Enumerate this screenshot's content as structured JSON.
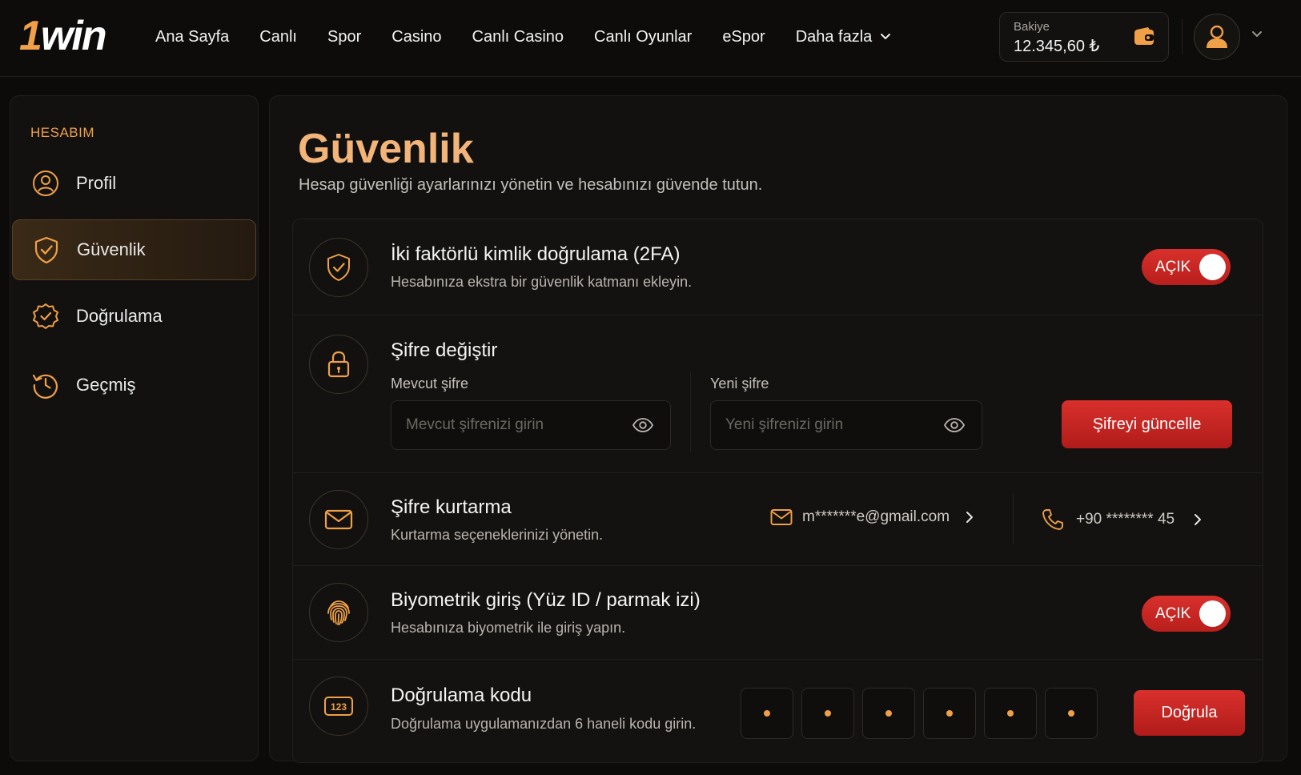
{
  "brand": {
    "logo_one": "1",
    "logo_rest": "win",
    "accent": "#f0a046",
    "danger": "#d32a27"
  },
  "nav": {
    "items": [
      "Ana Sayfa",
      "Canlı",
      "Spor",
      "Casino",
      "Canlı Casino",
      "Canlı Oyunlar",
      "eSpor"
    ],
    "more_label": "Daha fazla"
  },
  "balance": {
    "label": "Bakiye",
    "value": "12.345,60 ₺",
    "icon": "wallet-icon"
  },
  "sidebar": {
    "title": "HESABIM",
    "items": [
      {
        "label": "Profil",
        "icon": "user-circle-icon",
        "active": false
      },
      {
        "label": "Güvenlik",
        "icon": "shield-check-icon",
        "active": true
      },
      {
        "label": "Doğrulama",
        "icon": "badge-check-icon",
        "active": false
      },
      {
        "label": "Geçmiş",
        "icon": "history-icon",
        "active": false
      }
    ]
  },
  "page": {
    "title": "Güvenlik",
    "subtitle": "Hesap güvenliği ayarlarınızı yönetin ve hesabınızı güvende tutun."
  },
  "twofa": {
    "title": "İki faktörlü kimlik doğrulama (2FA)",
    "desc": "Hesabınıza ekstra bir güvenlik katmanı ekleyin.",
    "toggle_label": "AÇIK",
    "enabled": true
  },
  "password": {
    "title": "Şifre değiştir",
    "current_label": "Mevcut şifre",
    "current_placeholder": "Mevcut şifrenizi girin",
    "new_label": "Yeni şifre",
    "new_placeholder": "Yeni şifrenizi girin",
    "button": "Şifreyi güncelle"
  },
  "recovery": {
    "title": "Şifre kurtarma",
    "desc": "Kurtarma seçeneklerinizi yönetin.",
    "email": "m*******e@gmail.com",
    "phone": "+90 ******** 45"
  },
  "biometric": {
    "title": "Biyometrik giriş (Yüz ID / parmak izi)",
    "desc": "Hesabınıza biyometrik ile giriş yapın.",
    "toggle_label": "AÇIK",
    "enabled": true
  },
  "code": {
    "title": "Doğrulama kodu",
    "desc": "Doğrulama uygulamanızdan 6 haneli kodu girin.",
    "digits": 6,
    "button": "Doğrula"
  }
}
